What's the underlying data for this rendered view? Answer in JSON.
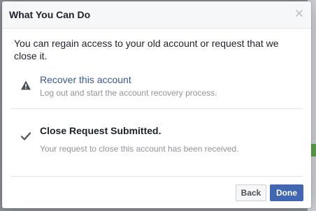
{
  "dialog": {
    "title": "What You Can Do",
    "close_icon": "close-icon",
    "intro": "You can regain access to your old account or request that we close it."
  },
  "options": {
    "recover": {
      "icon": "warning-icon",
      "title": "Recover this account",
      "description": "Log out and start the account recovery process."
    },
    "close": {
      "icon": "checkmark-icon",
      "title": "Close Request Submitted.",
      "description": "Your request to close this account has been received."
    }
  },
  "footer": {
    "back_label": "Back",
    "done_label": "Done"
  },
  "colors": {
    "link": "#365899",
    "primary_button": "#4267b2",
    "header_bg": "#f6f7f9",
    "muted_text": "#90949c"
  }
}
